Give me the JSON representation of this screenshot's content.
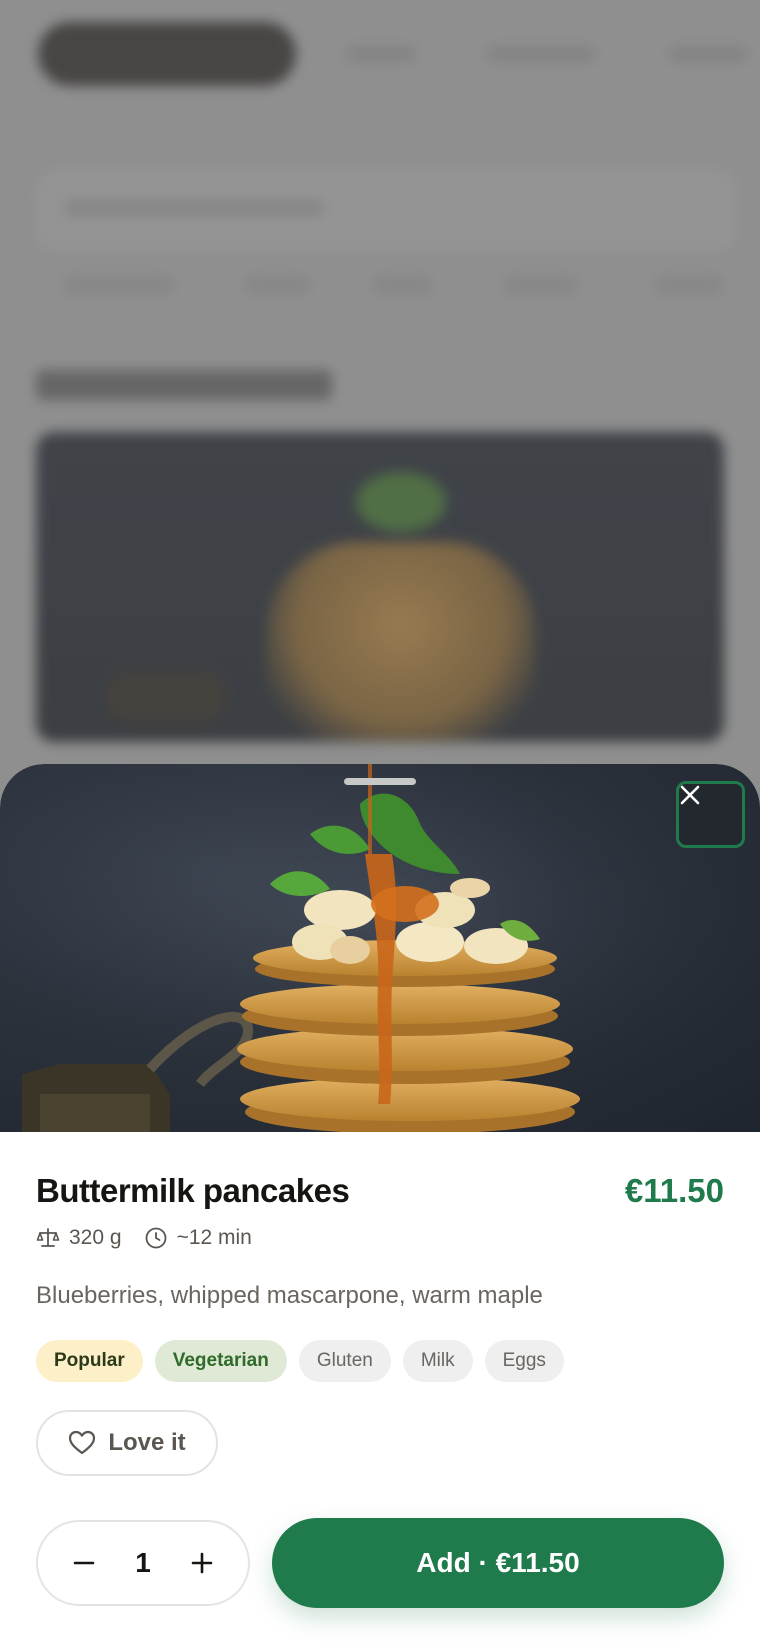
{
  "product": {
    "name": "Buttermilk pancakes",
    "price": "€11.50",
    "weight": "320 g",
    "prep_time": "~12 min",
    "description": "Blueberries, whipped mascarpone, warm maple",
    "tags": [
      {
        "label": "Popular",
        "kind": "popular"
      },
      {
        "label": "Vegetarian",
        "kind": "diet"
      },
      {
        "label": "Gluten",
        "kind": "allergen"
      },
      {
        "label": "Milk",
        "kind": "allergen"
      },
      {
        "label": "Eggs",
        "kind": "allergen"
      }
    ]
  },
  "actions": {
    "favorite_label": "Love it",
    "quantity": "1",
    "add_label": "Add · €11.50"
  },
  "icons": {
    "close": "close-icon",
    "weight": "scale-icon",
    "time": "clock-icon",
    "favorite": "heart-icon",
    "decrement": "minus-icon",
    "increment": "plus-icon"
  },
  "colors": {
    "accent": "#1f7a4c",
    "popular_tag_bg": "#fdefc8",
    "vegetarian_tag_bg": "#dfe9d6",
    "allergen_tag_bg": "#efefef"
  }
}
